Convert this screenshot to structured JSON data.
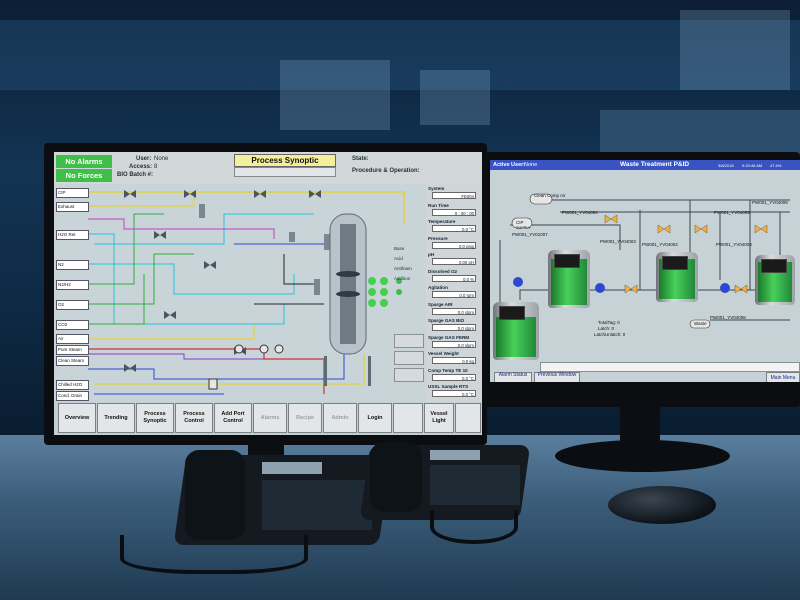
{
  "monitor_left": {
    "alarms": {
      "no_alarms": "No Alarms",
      "no_forces": "No Forces"
    },
    "header": {
      "user_label": "User:",
      "user_value": "None",
      "access_label": "Access:",
      "access_value": "8",
      "batch_label": "BIO Batch #:",
      "title": "Process Synoptic",
      "state_label": "State:",
      "procedure_label": "Procedure & Operation:"
    },
    "input_tags": [
      "CIP",
      "Exhaust",
      "H2O Ret",
      "N2",
      "N2/H2",
      "O2",
      "CO2",
      "Air",
      "Pure Steam",
      "Clean Steam",
      "Chilled H2O",
      "Cond. Drain"
    ],
    "right_panel": [
      {
        "label": "System",
        "value": "FE004"
      },
      {
        "label": "Run Time",
        "value": "0 : 00 : 00"
      },
      {
        "label": "Temperature",
        "value": "0.0     °C"
      },
      {
        "label": "Pressure",
        "value": "0.0     psig"
      },
      {
        "label": "pH",
        "value": "0.00    pH"
      },
      {
        "label": "Dissolved O2",
        "value": "0.0     %"
      },
      {
        "label": "Agitation",
        "value": "0.0     rpm"
      },
      {
        "label": "Sparge AIR",
        "value": "0.0     slpm"
      },
      {
        "label": "Sparge GAS BIO",
        "value": "0.0     slpm"
      },
      {
        "label": "Sparge GAS FERM",
        "value": "0.0     slpm"
      },
      {
        "label": "Vessel Weight",
        "value": "0.0     kg"
      },
      {
        "label": "Comp Temp TE 10",
        "value": "0.0     °C"
      },
      {
        "label": "USSL Sample RTS",
        "value": "0.0     °C"
      }
    ],
    "side_labels": {
      "base": "Base",
      "acid": "Acid",
      "antifoam": "Antifoam",
      "addition": "Addition"
    },
    "buttons": [
      "Overview",
      "Trending",
      "Process Synoptic",
      "Process Control",
      "Add Port Control",
      "Alarms",
      "Recipe",
      "Admin",
      "Login",
      "",
      "Vessel Light",
      ""
    ]
  },
  "monitor_right": {
    "header": {
      "active_user_label": "Active User:",
      "active_user_value": "None",
      "title": "Waste Treatment P&ID",
      "date": "3/8/2018",
      "time": "9:23:46 AM",
      "signal": "47.4%"
    },
    "labels": {
      "clean_comp_air": "Clean Comp Air",
      "cip": "CIP",
      "cip_sub": "SUPPLY",
      "pw_vv4004": "PW001_YV04004",
      "pw_vv1007": "PW001_YV01007",
      "pw_vv4003": "PW001_YV04003",
      "pw_vv4002": "PW001_YV04002",
      "pw_vv4005": "PW001_YV04005",
      "pw_vv4003b": "PW001_YV04003",
      "pw_vv4009": "PW001_YV04009",
      "pw_vv4008": "PW001_YV04008",
      "waste": "Waste",
      "totals_a": "TotalTag: 0",
      "totals_b": "Latch: 0",
      "totals_c": "LatchUnlatch: 0"
    },
    "buttons": {
      "alarm_status": "Alarm Status",
      "previous_window": "Previous Window",
      "main_menu": "Main Menu"
    }
  }
}
